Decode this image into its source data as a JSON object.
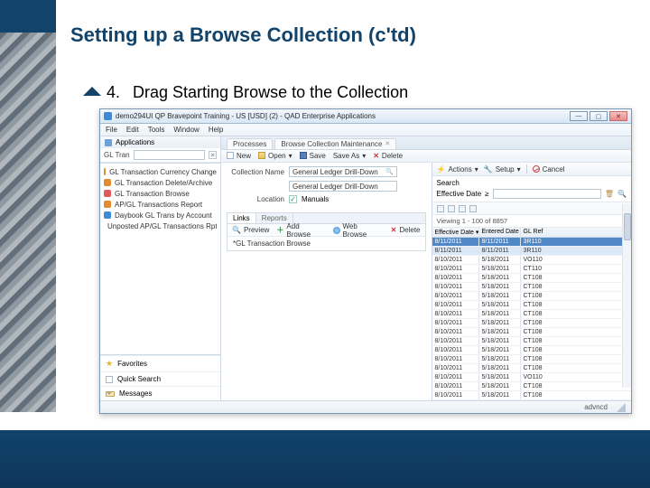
{
  "slide": {
    "title": "Setting up a Browse Collection (c'td)",
    "bullet_number": "4.",
    "bullet_text": "Drag Starting Browse to the Collection"
  },
  "window": {
    "title": "demo294UI QP Bravepoint Training - US [USD] (2) - QAD Enterprise Applications",
    "win_min": "—",
    "win_max": "▢",
    "win_close": "✕",
    "menu": [
      "File",
      "Edit",
      "Tools",
      "Window",
      "Help"
    ]
  },
  "sidebar": {
    "apps_header": "Applications",
    "filter_label": "GL Tran",
    "tree": [
      {
        "label": "GL Transaction Currency Change",
        "icon": "a"
      },
      {
        "label": "GL Transaction Delete/Archive",
        "icon": "a"
      },
      {
        "label": "GL Transaction Browse",
        "icon": "b"
      },
      {
        "label": "AP/GL Transactions Report",
        "icon": "a"
      },
      {
        "label": "Daybook GL Trans by Account",
        "icon": "c"
      },
      {
        "label": "Unposted AP/GL Transactions Rpt",
        "icon": "a"
      }
    ],
    "favorites": "Favorites",
    "quick_search": "Quick Search",
    "messages": "Messages"
  },
  "main": {
    "tabs": [
      {
        "label": "Processes"
      },
      {
        "label": "Browse Collection Maintenance"
      }
    ],
    "toolbar": {
      "new": "New",
      "open": "Open",
      "dd": "▾",
      "save": "Save",
      "saveas": "Save As",
      "delete": "Delete"
    },
    "form": {
      "collection_label": "Collection Name",
      "collection_value": "General Ledger Drill-Down",
      "desc_value": "General Ledger Drill-Down",
      "location_label": "Location",
      "manuals_chk": "✓",
      "manuals_label": "Manuals"
    },
    "subtabs": {
      "links": "Links",
      "reports": "Reports"
    },
    "subtoolbar": {
      "preview": "Preview",
      "add": "Add Browse",
      "web": "Web Browse",
      "delete": "Delete"
    },
    "sublist_item": "*GL Transaction Browse"
  },
  "right": {
    "toolbar": {
      "actions": "Actions",
      "setup": "Setup",
      "cancel": "Cancel"
    },
    "search": {
      "label": "Search",
      "field": "Effective Date",
      "op": "≥"
    },
    "viewing": "Viewing 1 - 100 of 8857",
    "grid_headers": {
      "c1": "Effective Date  ▾",
      "c2": "Entered Date",
      "c3": "GL Ref"
    },
    "rows": [
      {
        "d1": "8/11/2011",
        "d2": "8/11/2011",
        "d3": "3R110",
        "sel": true
      },
      {
        "d1": "8/11/2011",
        "d2": "8/11/2011",
        "d3": "3R110",
        "sel2": true
      },
      {
        "d1": "8/10/2011",
        "d2": "5/18/2011",
        "d3": "VO110"
      },
      {
        "d1": "8/10/2011",
        "d2": "5/18/2011",
        "d3": "CT110"
      },
      {
        "d1": "8/10/2011",
        "d2": "5/18/2011",
        "d3": "CT108"
      },
      {
        "d1": "8/10/2011",
        "d2": "5/18/2011",
        "d3": "CT108"
      },
      {
        "d1": "8/10/2011",
        "d2": "5/18/2011",
        "d3": "CT108"
      },
      {
        "d1": "8/10/2011",
        "d2": "5/18/2011",
        "d3": "CT108"
      },
      {
        "d1": "8/10/2011",
        "d2": "5/18/2011",
        "d3": "CT108"
      },
      {
        "d1": "8/10/2011",
        "d2": "5/18/2011",
        "d3": "CT108"
      },
      {
        "d1": "8/10/2011",
        "d2": "5/18/2011",
        "d3": "CT108"
      },
      {
        "d1": "8/10/2011",
        "d2": "5/18/2011",
        "d3": "CT108"
      },
      {
        "d1": "8/10/2011",
        "d2": "5/18/2011",
        "d3": "CT108"
      },
      {
        "d1": "8/10/2011",
        "d2": "5/18/2011",
        "d3": "CT108"
      },
      {
        "d1": "8/10/2011",
        "d2": "5/18/2011",
        "d3": "CT108"
      },
      {
        "d1": "8/10/2011",
        "d2": "5/18/2011",
        "d3": "VO110"
      },
      {
        "d1": "8/10/2011",
        "d2": "5/18/2011",
        "d3": "CT108"
      },
      {
        "d1": "8/10/2011",
        "d2": "5/18/2011",
        "d3": "CT108"
      }
    ]
  },
  "status": {
    "user": "advncd"
  }
}
